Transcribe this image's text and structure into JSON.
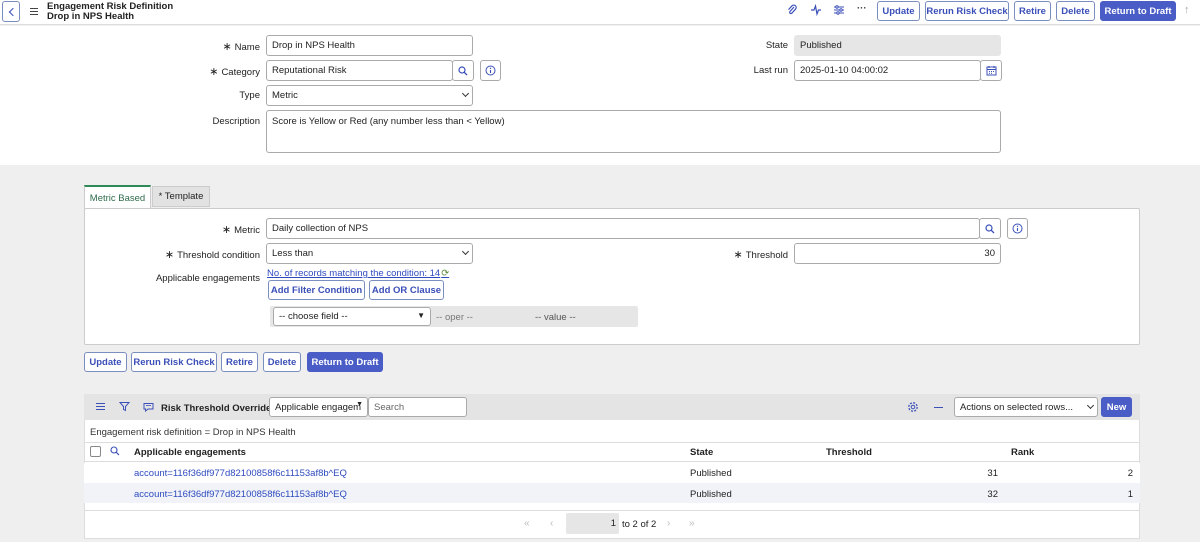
{
  "header": {
    "record_type": "Engagement Risk Definition",
    "record_name": "Drop in NPS Health",
    "buttons": {
      "update": "Update",
      "rerun": "Rerun Risk Check",
      "retire": "Retire",
      "delete": "Delete",
      "return_draft": "Return to Draft"
    },
    "more_glyph": "···"
  },
  "form": {
    "name_label": "Name",
    "name_value": "Drop in NPS Health",
    "category_label": "Category",
    "category_value": "Reputational Risk",
    "type_label": "Type",
    "type_value": "Metric",
    "description_label": "Description",
    "description_value": "Score is Yellow or Red (any number less than < Yellow)",
    "state_label": "State",
    "state_value": "Published",
    "lastrun_label": "Last run",
    "lastrun_value": "2025-01-10 04:00:02"
  },
  "tabs": [
    {
      "label": "Metric Based"
    },
    {
      "label": "* Template"
    }
  ],
  "metric": {
    "metric_label": "Metric",
    "metric_value": "Daily collection of NPS",
    "threshold_cond_label": "Threshold condition",
    "threshold_cond_value": "Less than",
    "threshold_label": "Threshold",
    "threshold_value": "30",
    "applicable_label": "Applicable engagements",
    "records_link": "No. of records matching the condition: 14",
    "add_filter": "Add Filter Condition",
    "add_or": "Add OR Clause",
    "choose_field": "-- choose field --",
    "oper": "-- oper --",
    "value": "-- value --"
  },
  "bottom_buttons": {
    "update": "Update",
    "rerun": "Rerun Risk Check",
    "retire": "Retire",
    "delete": "Delete",
    "return_draft": "Return to Draft"
  },
  "related_list": {
    "title": "Risk Threshold Overrides",
    "search_field": "Applicable engagem",
    "search_placeholder": "Search",
    "actions": "Actions on selected rows...",
    "new_label": "New",
    "breadcrumb": "Engagement risk definition = Drop in NPS Health",
    "columns": [
      "Applicable engagements",
      "State",
      "Threshold",
      "Rank"
    ],
    "rows": [
      {
        "engagement": "account=116f36df977d82100858f6c11153af8b^EQ",
        "state": "Published",
        "threshold": "31",
        "rank": "2"
      },
      {
        "engagement": "account=116f36df977d82100858f6c11153af8b^EQ",
        "state": "Published",
        "threshold": "32",
        "rank": "1"
      }
    ],
    "pagination": {
      "current": "1",
      "range": "to 2 of 2"
    }
  },
  "colors": {
    "accent": "#4a5cc5",
    "link": "#2e4bbf",
    "tab_active": "#2e8b57"
  }
}
